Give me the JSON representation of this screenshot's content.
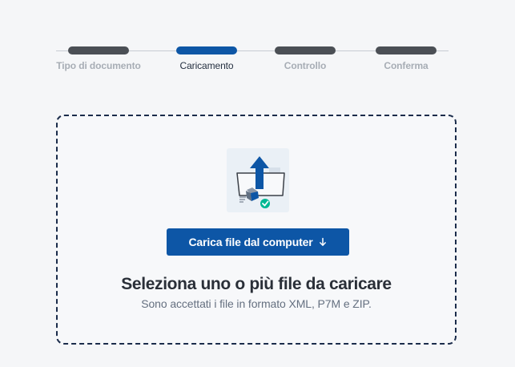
{
  "stepper": {
    "steps": [
      {
        "label": "Tipo di documento",
        "state": "completed"
      },
      {
        "label": "Caricamento",
        "state": "active"
      },
      {
        "label": "Controllo",
        "state": "pending"
      },
      {
        "label": "Conferma",
        "state": "pending"
      }
    ]
  },
  "dropzone": {
    "illustration_icon": "upload-folder-illustration",
    "button_label": "Carica file dal computer",
    "button_icon": "arrow-down-icon",
    "title": "Seleziona uno o più file da caricare",
    "subtitle": "Sono accettati i file in formato XML, P7M e ZIP."
  },
  "colors": {
    "background": "#f5f6f8",
    "primary": "#0d56a6",
    "step_default": "#4b4f55",
    "dropzone_border": "#1b2c4b",
    "success": "#00b894"
  }
}
